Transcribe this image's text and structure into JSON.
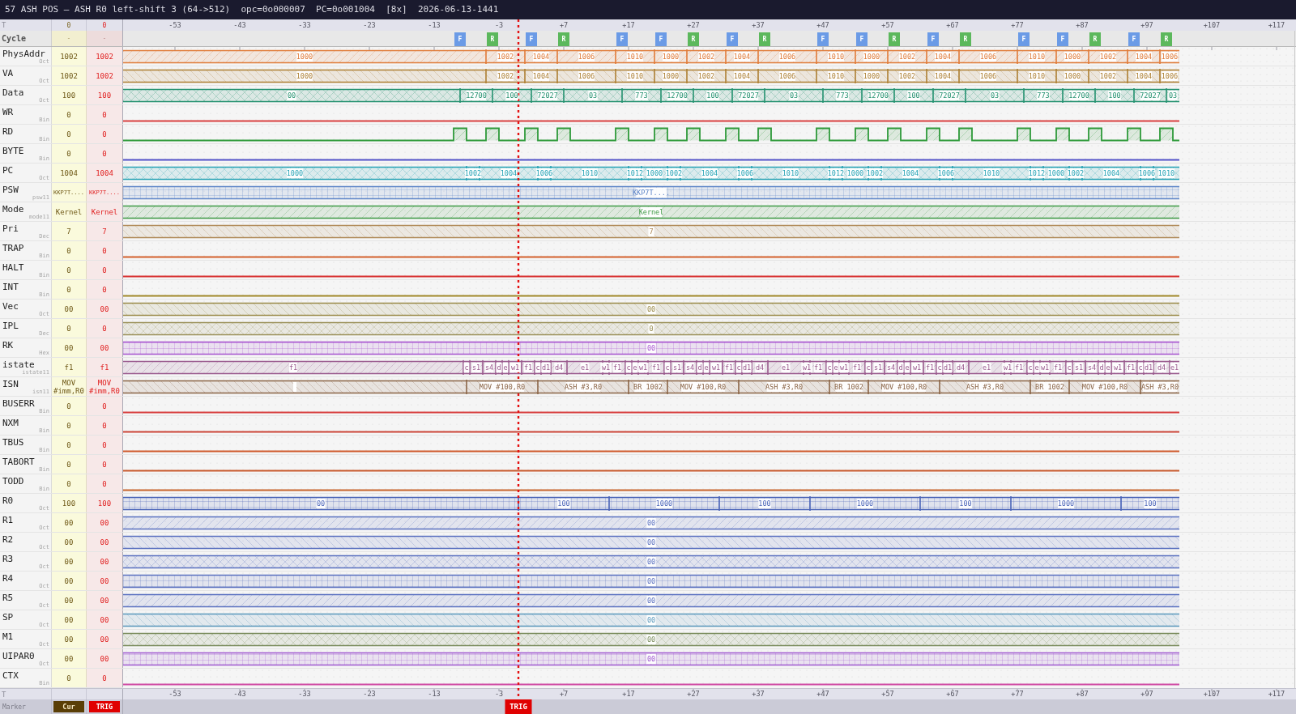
{
  "window": {
    "title": "57 ASH POS — ASH R0 left-shift 3 (64->512)  opc=0o000007  PC=0o001004  [8x]  2026-06-13-1441"
  },
  "waveform": {
    "header": {
      "label": "T",
      "cursor_time": "0",
      "trigger_time": "0",
      "ticks": [
        "-53",
        "-43",
        "-33",
        "-23",
        "-13",
        "-3",
        "+7",
        "+17",
        "+27",
        "+37",
        "+47",
        "+57",
        "+67",
        "+77",
        "+87",
        "+97",
        "+107",
        "+117"
      ]
    },
    "cycle_row": {
      "label": "Cycle",
      "cursor_value": "-",
      "trigger_value": "-",
      "markers": [
        {
          "label": "F",
          "kind": "fetch"
        },
        {
          "label": "R",
          "kind": "read"
        },
        {
          "label": "F",
          "kind": "fetch"
        },
        {
          "label": "R",
          "kind": "read"
        },
        {
          "label": "F",
          "kind": "fetch"
        },
        {
          "label": "F",
          "kind": "fetch"
        },
        {
          "label": "R",
          "kind": "read"
        },
        {
          "label": "F",
          "kind": "fetch"
        },
        {
          "label": "R",
          "kind": "read"
        },
        {
          "label": "F",
          "kind": "fetch"
        },
        {
          "label": "F",
          "kind": "fetch"
        },
        {
          "label": "R",
          "kind": "read"
        },
        {
          "label": "F",
          "kind": "fetch"
        },
        {
          "label": "R",
          "kind": "read"
        },
        {
          "label": "F",
          "kind": "fetch"
        },
        {
          "label": "F",
          "kind": "fetch"
        },
        {
          "label": "R",
          "kind": "read"
        },
        {
          "label": "F",
          "kind": "fetch"
        },
        {
          "label": "R",
          "kind": "read"
        }
      ]
    },
    "signals": [
      {
        "name": "PhysAddr",
        "format": "Oct",
        "cursor_value": "1002",
        "trigger_value": "1002",
        "kind": "bus",
        "color": "#e07b39",
        "values": [
          "1000",
          "1002",
          "1004",
          "1006",
          "1010",
          "1000",
          "1002",
          "1004",
          "1006",
          "1010",
          "1000",
          "1002",
          "1004",
          "1006",
          "1010",
          "1000",
          "1002",
          "1004",
          "1006"
        ]
      },
      {
        "name": "VA",
        "format": "Oct",
        "cursor_value": "1002",
        "trigger_value": "1002",
        "kind": "bus",
        "color": "#ad7f32",
        "values": [
          "1000",
          "1002",
          "1004",
          "1006",
          "1010",
          "1000",
          "1002",
          "1004",
          "1006",
          "1010",
          "1000",
          "1002",
          "1004",
          "1006",
          "1010",
          "1000",
          "1002",
          "1004",
          "1006"
        ]
      },
      {
        "name": "Data",
        "format": "Oct",
        "cursor_value": "100",
        "trigger_value": "100",
        "kind": "bus",
        "color": "#23916f",
        "values": [
          "00",
          "12700",
          "100",
          "72027",
          "03",
          "773",
          "12700",
          "100",
          "72027",
          "03",
          "773",
          "12700",
          "100",
          "72027",
          "03",
          "773",
          "12700",
          "100",
          "72027",
          "03"
        ]
      },
      {
        "name": "WR",
        "format": "Bin",
        "cursor_value": "0",
        "trigger_value": "0",
        "kind": "bit",
        "color": "#d94040"
      },
      {
        "name": "RD",
        "format": "Bin",
        "cursor_value": "0",
        "trigger_value": "0",
        "kind": "bit",
        "color": "#2e9a3a"
      },
      {
        "name": "BYTE",
        "format": "Bin",
        "cursor_value": "0",
        "trigger_value": "0",
        "kind": "bit",
        "color": "#5050c8"
      },
      {
        "name": "PC",
        "format": "Oct",
        "cursor_value": "1004",
        "trigger_value": "1004",
        "kind": "bus",
        "color": "#27a3b5",
        "values": [
          "1000",
          "1002",
          "1004",
          "1006",
          "1010",
          "1012",
          "1000",
          "1002",
          "1004",
          "1006",
          "1010",
          "1012",
          "1000",
          "1002",
          "1004",
          "1006",
          "1010",
          "1012",
          "1000",
          "1002",
          "1004",
          "1006",
          "1010"
        ]
      },
      {
        "name": "PSW",
        "format": "psw11",
        "cursor_value": "KKP7T....",
        "trigger_value": "KKP7T....",
        "kind": "bus",
        "color": "#5f86c8",
        "values": [
          "KKP7T...."
        ]
      },
      {
        "name": "Mode",
        "format": "mode11",
        "cursor_value": "Kernel",
        "trigger_value": "Kernel",
        "kind": "bus",
        "color": "#3f9a45",
        "values": [
          "Kernel"
        ]
      },
      {
        "name": "Pri",
        "format": "Dec",
        "cursor_value": "7",
        "trigger_value": "7",
        "kind": "bus",
        "color": "#b08a58",
        "values": [
          "7"
        ]
      },
      {
        "name": "TRAP",
        "format": "Bin",
        "cursor_value": "0",
        "trigger_value": "0",
        "kind": "bit",
        "color": "#d4602c"
      },
      {
        "name": "HALT",
        "format": "Bin",
        "cursor_value": "0",
        "trigger_value": "0",
        "kind": "bit",
        "color": "#d83030"
      },
      {
        "name": "INT",
        "format": "Bin",
        "cursor_value": "0",
        "trigger_value": "0",
        "kind": "bit",
        "color": "#a08828"
      },
      {
        "name": "Vec",
        "format": "Oct",
        "cursor_value": "00",
        "trigger_value": "00",
        "kind": "bus",
        "color": "#9a8a48",
        "values": [
          "00"
        ]
      },
      {
        "name": "IPL",
        "format": "Dec",
        "cursor_value": "0",
        "trigger_value": "0",
        "kind": "bus",
        "color": "#9a9058",
        "values": [
          "0"
        ]
      },
      {
        "name": "RK",
        "format": "Hex",
        "cursor_value": "00",
        "trigger_value": "00",
        "kind": "bus",
        "color": "#a855d0",
        "values": [
          "00"
        ]
      },
      {
        "name": "istate",
        "format": "istate11",
        "cursor_value": "f1",
        "trigger_value": "f1",
        "kind": "bus",
        "color": "#9a5a8e",
        "values": [
          "f1",
          "c",
          "s1",
          "s4",
          "d",
          "e",
          "w1",
          "f1",
          "c",
          "d1",
          "d4",
          "e1",
          "w1",
          "f1",
          "c",
          "e",
          "w1",
          "f1",
          "c",
          "s1",
          "s4",
          "d",
          "e",
          "w1",
          "f1",
          "c",
          "d1",
          "d4",
          "e1",
          "w1",
          "f1",
          "c",
          "e",
          "w1",
          "f1",
          "c",
          "s1",
          "s4",
          "d",
          "e",
          "w1",
          "f1",
          "c",
          "d1",
          "d4",
          "e1",
          "w1",
          "f1",
          "c",
          "e",
          "w1",
          "f1",
          "c",
          "s1",
          "s4",
          "d",
          "e",
          "w1",
          "f1",
          "c",
          "d1",
          "d4",
          "e1"
        ]
      },
      {
        "name": "ISN",
        "format": "isn11",
        "cursor_value": "MOV #imm,R0",
        "trigger_value": "MOV #imm,R0",
        "kind": "bus",
        "color": "#8a6446",
        "values": [
          "MOV #100,R0",
          "ASH #3,R0",
          "BR 1002",
          "MOV #100,R0",
          "ASH #3,R0",
          "BR 1002",
          "MOV #100,R0",
          "ASH #3,R0",
          "BR 1002",
          "MOV #100,R0",
          "ASH #3,R0"
        ]
      },
      {
        "name": "BUSERR",
        "format": "Bin",
        "cursor_value": "0",
        "trigger_value": "0",
        "kind": "bit",
        "color": "#d84040"
      },
      {
        "name": "NXM",
        "format": "Bin",
        "cursor_value": "0",
        "trigger_value": "0",
        "kind": "bit",
        "color": "#cc4436"
      },
      {
        "name": "TBUS",
        "format": "Bin",
        "cursor_value": "0",
        "trigger_value": "0",
        "kind": "bit",
        "color": "#d05a2c"
      },
      {
        "name": "TABORT",
        "format": "Bin",
        "cursor_value": "0",
        "trigger_value": "0",
        "kind": "bit",
        "color": "#c8582c"
      },
      {
        "name": "TODD",
        "format": "Bin",
        "cursor_value": "0",
        "trigger_value": "0",
        "kind": "bit",
        "color": "#c8642c"
      },
      {
        "name": "R0",
        "format": "Oct",
        "cursor_value": "100",
        "trigger_value": "100",
        "kind": "bus",
        "color": "#4a64b8",
        "values": [
          "00",
          "100",
          "1000",
          "100",
          "1000",
          "100",
          "1000",
          "100"
        ]
      },
      {
        "name": "R1",
        "format": "Oct",
        "cursor_value": "00",
        "trigger_value": "00",
        "kind": "bus",
        "color": "#5a70c0",
        "values": [
          "00"
        ]
      },
      {
        "name": "R2",
        "format": "Oct",
        "cursor_value": "00",
        "trigger_value": "00",
        "kind": "bus",
        "color": "#5a70c0",
        "values": [
          "00"
        ]
      },
      {
        "name": "R3",
        "format": "Oct",
        "cursor_value": "00",
        "trigger_value": "00",
        "kind": "bus",
        "color": "#5a70c0",
        "values": [
          "00"
        ]
      },
      {
        "name": "R4",
        "format": "Oct",
        "cursor_value": "00",
        "trigger_value": "00",
        "kind": "bus",
        "color": "#5a70c0",
        "values": [
          "00"
        ]
      },
      {
        "name": "R5",
        "format": "Oct",
        "cursor_value": "00",
        "trigger_value": "00",
        "kind": "bus",
        "color": "#5a70c0",
        "values": [
          "00"
        ]
      },
      {
        "name": "SP",
        "format": "Oct",
        "cursor_value": "00",
        "trigger_value": "00",
        "kind": "bus",
        "color": "#5a98bc",
        "values": [
          "00"
        ]
      },
      {
        "name": "M1",
        "format": "Oct",
        "cursor_value": "00",
        "trigger_value": "00",
        "kind": "bus",
        "color": "#7a8c5c",
        "values": [
          "00"
        ]
      },
      {
        "name": "UIPAR0",
        "format": "Oct",
        "cursor_value": "00",
        "trigger_value": "00",
        "kind": "bus",
        "color": "#a05ad0",
        "values": [
          "00"
        ]
      },
      {
        "name": "CTX",
        "format": "Bin",
        "cursor_value": "0",
        "trigger_value": "0",
        "kind": "bit",
        "color": "#d04aa4"
      }
    ],
    "footer": {
      "label": "T",
      "ticks": [
        "-53",
        "-43",
        "-33",
        "-23",
        "-13",
        "-3",
        "+7",
        "+17",
        "+27",
        "+37",
        "+47",
        "+57",
        "+67",
        "+77",
        "+87",
        "+97",
        "+107",
        "+117"
      ]
    },
    "marker_bar": {
      "label": "Marker",
      "buttons": [
        {
          "label": "Cur",
          "kind": "cursor"
        },
        {
          "label": "TRIG",
          "kind": "trigger"
        }
      ],
      "trigger_flag": "TRIG"
    }
  }
}
